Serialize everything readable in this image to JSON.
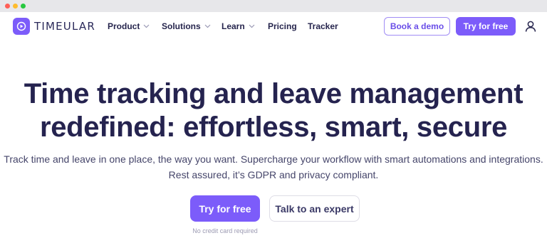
{
  "brand": {
    "name": "TIMEULAR",
    "accent": "#7c5cfa",
    "text": "#25234f"
  },
  "nav": {
    "items": [
      {
        "label": "Product",
        "has_dropdown": true
      },
      {
        "label": "Solutions",
        "has_dropdown": true
      },
      {
        "label": "Learn",
        "has_dropdown": true
      },
      {
        "label": "Pricing",
        "has_dropdown": false
      },
      {
        "label": "Tracker",
        "has_dropdown": false
      }
    ],
    "book_demo_label": "Book a demo",
    "try_free_label": "Try for free",
    "user_icon": "user-icon"
  },
  "hero": {
    "title_line1": "Time tracking and leave management",
    "title_line2": "redefined: effortless, smart, secure",
    "subtitle_line1": "Track time and leave in one place, the way you want. Supercharge your workflow with smart automations and integrations.",
    "subtitle_line2": "Rest assured, it’s GDPR and privacy compliant.",
    "primary_cta": "Try for free",
    "secondary_cta": "Talk to an expert",
    "note": "No credit card required"
  }
}
